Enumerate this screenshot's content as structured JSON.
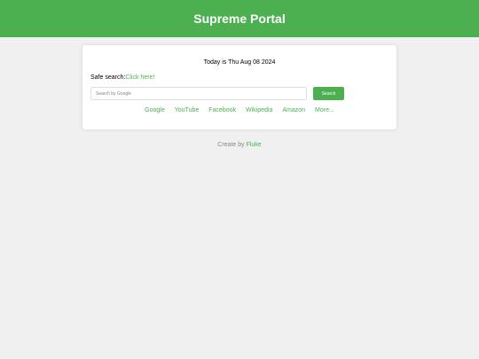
{
  "header": {
    "title": "Supreme Portal"
  },
  "main": {
    "date_text": "Today is Thu Aug 08 2024",
    "safe_search_label": "Safe search:",
    "safe_search_link": "Click here!",
    "search": {
      "placeholder": "Search by Google",
      "value": "",
      "button_label": "Search"
    },
    "quick_links": [
      {
        "label": "Google"
      },
      {
        "label": "YouTube"
      },
      {
        "label": "Facebook"
      },
      {
        "label": "Wikipedia"
      },
      {
        "label": "Amazon"
      },
      {
        "label": "More..."
      }
    ]
  },
  "footer": {
    "prefix": "Create by ",
    "author_link": "Fluke"
  },
  "colors": {
    "accent": "#4caf50",
    "background": "#f0f0f0",
    "card": "#ffffff"
  }
}
